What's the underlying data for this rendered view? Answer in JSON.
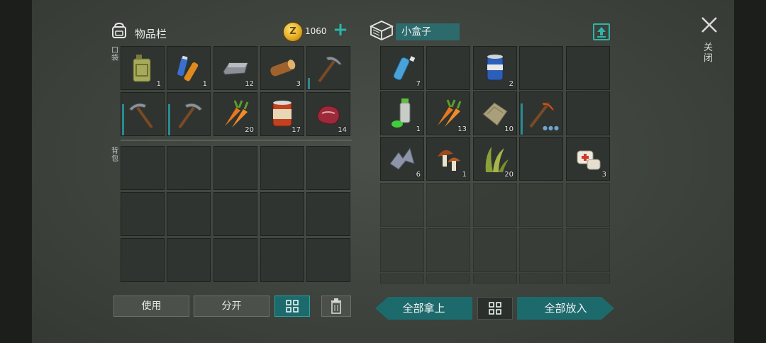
{
  "inventory": {
    "title": "物品栏",
    "pocket_label": "口袋",
    "backpack_label": "背包",
    "coins": "1060",
    "coin_icon_letter": "Z",
    "add_coins_symbol": "+",
    "pocket_slots": [
      {
        "icon": "fuel-canister-icon",
        "qty": "1"
      },
      {
        "icon": "batteries-icon",
        "qty": "1"
      },
      {
        "icon": "iron-ingot-icon",
        "qty": "12"
      },
      {
        "icon": "wood-log-icon",
        "qty": "3"
      },
      {
        "icon": "pickaxe-icon",
        "qty": "",
        "durability": "low"
      },
      {
        "icon": "pickaxe-icon",
        "qty": "",
        "durability": "full"
      },
      {
        "icon": "pickaxe-icon",
        "qty": "",
        "durability": "full"
      },
      {
        "icon": "carrot-icon",
        "qty": "20"
      },
      {
        "icon": "canned-food-icon",
        "qty": "17"
      },
      {
        "icon": "raw-meat-icon",
        "qty": "14"
      }
    ],
    "buttons": {
      "use": "使用",
      "split": "分开",
      "sort": "grid-icon",
      "delete": "trash-icon"
    }
  },
  "container": {
    "name": "小盒子",
    "slots": [
      {
        "icon": "water-bottle-icon",
        "qty": "7"
      },
      {
        "icon": "",
        "qty": ""
      },
      {
        "icon": "soda-can-icon",
        "qty": "2"
      },
      {
        "icon": "",
        "qty": ""
      },
      {
        "icon": "",
        "qty": ""
      },
      {
        "icon": "spray-paint-icon",
        "qty": "1"
      },
      {
        "icon": "carrot-icon",
        "qty": "13"
      },
      {
        "icon": "cloth-icon",
        "qty": "10"
      },
      {
        "icon": "pickaxe-icon",
        "qty": "",
        "durability": "full",
        "dots": true
      },
      {
        "icon": "",
        "qty": ""
      },
      {
        "icon": "metal-scrap-icon",
        "qty": "6"
      },
      {
        "icon": "mushroom-icon",
        "qty": "1"
      },
      {
        "icon": "plant-fiber-icon",
        "qty": "20"
      },
      {
        "icon": "",
        "qty": ""
      },
      {
        "icon": "bandage-icon",
        "qty": "3"
      }
    ],
    "buttons": {
      "take_all": "全部拿上",
      "sort": "grid-icon",
      "put_all": "全部放入"
    }
  },
  "close_label": "关闭",
  "colors": {
    "accent": "#1d6a6d",
    "accent_light": "#2fb4a8",
    "slot": "#2f3430"
  }
}
